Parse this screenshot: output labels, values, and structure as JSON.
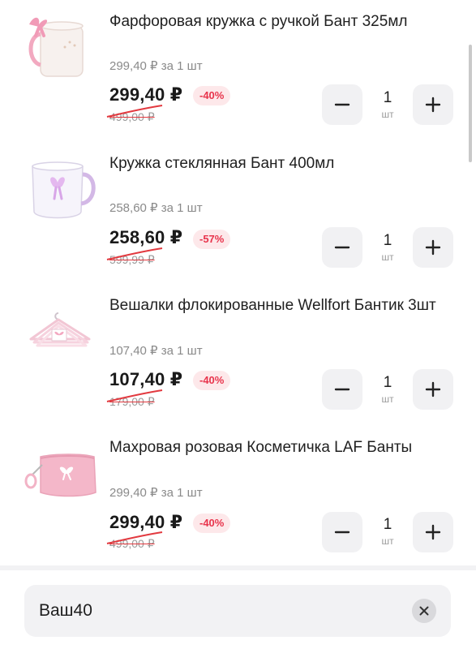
{
  "cart": {
    "items": [
      {
        "title": "Фарфоровая кружка с ручкой Бант 325мл",
        "unit_price": "299,40 ₽ за 1 шт",
        "price": "299,40 ₽",
        "discount": "-40%",
        "old_price": "499,00 ₽",
        "quantity": "1",
        "quantity_unit": "шт",
        "image": "mug-with-bow-icon"
      },
      {
        "title": "Кружка стеклянная Бант 400мл",
        "unit_price": "258,60 ₽ за 1 шт",
        "price": "258,60 ₽",
        "discount": "-57%",
        "old_price": "599,99 ₽",
        "quantity": "1",
        "quantity_unit": "шт",
        "image": "glass-mug-icon"
      },
      {
        "title": "Вешалки флокированные Wellfort Бантик 3шт",
        "unit_price": "107,40 ₽ за 1 шт",
        "price": "107,40 ₽",
        "discount": "-40%",
        "old_price": "179,00 ₽",
        "quantity": "1",
        "quantity_unit": "шт",
        "image": "hangers-icon"
      },
      {
        "title": "Махровая розовая Косметичка LAF Банты",
        "unit_price": "299,40 ₽ за 1 шт",
        "price": "299,40 ₽",
        "discount": "-40%",
        "old_price": "499,00 ₽",
        "quantity": "1",
        "quantity_unit": "шт",
        "image": "cosmetic-bag-icon"
      }
    ]
  },
  "search": {
    "value": "Ваш40"
  },
  "colors": {
    "discount": "#e8344c",
    "discount_bg": "#fde8ea",
    "stepper_bg": "#f1f1f3"
  }
}
